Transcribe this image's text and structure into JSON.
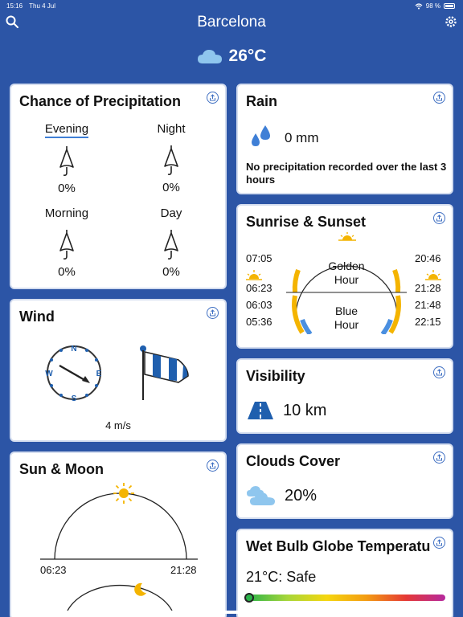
{
  "status": {
    "time": "15:16",
    "date": "Thu 4 Jul",
    "battery": "98 %"
  },
  "header": {
    "city": "Barcelona",
    "current_temp": "26°C"
  },
  "precipitation": {
    "title": "Chance of Precipitation",
    "periods": [
      {
        "label": "Evening",
        "value": "0%"
      },
      {
        "label": "Night",
        "value": "0%"
      },
      {
        "label": "Morning",
        "value": "0%"
      },
      {
        "label": "Day",
        "value": "0%"
      }
    ]
  },
  "rain": {
    "title": "Rain",
    "amount": "0 mm",
    "note": "No precipitation recorded over the last 3 hours"
  },
  "sunrise": {
    "title": "Sunrise & Sunset",
    "left_times": [
      "07:05",
      "06:23",
      "06:03",
      "05:36"
    ],
    "right_times": [
      "20:46",
      "21:28",
      "21:48",
      "22:15"
    ],
    "golden_line1": "Golden",
    "golden_line2": "Hour",
    "blue_line1": "Blue",
    "blue_line2": "Hour"
  },
  "wind": {
    "title": "Wind",
    "speed": "4 m/s",
    "compass": {
      "n": "N",
      "e": "E",
      "s": "S",
      "w": "W"
    }
  },
  "visibility": {
    "title": "Visibility",
    "value": "10 km"
  },
  "sun_moon": {
    "title": "Sun & Moon",
    "sunrise": "06:23",
    "sunset": "21:28"
  },
  "clouds": {
    "title": "Clouds Cover",
    "value": "20%"
  },
  "wbgt": {
    "title": "Wet Bulb Globe Temperatu",
    "value": "21°C: Safe",
    "level": 0.01
  },
  "colors": {
    "background": "#2c55a6",
    "accent": "#3f6fc2",
    "golden": "#f4b400",
    "blue_hour": "#4a8fe0"
  }
}
